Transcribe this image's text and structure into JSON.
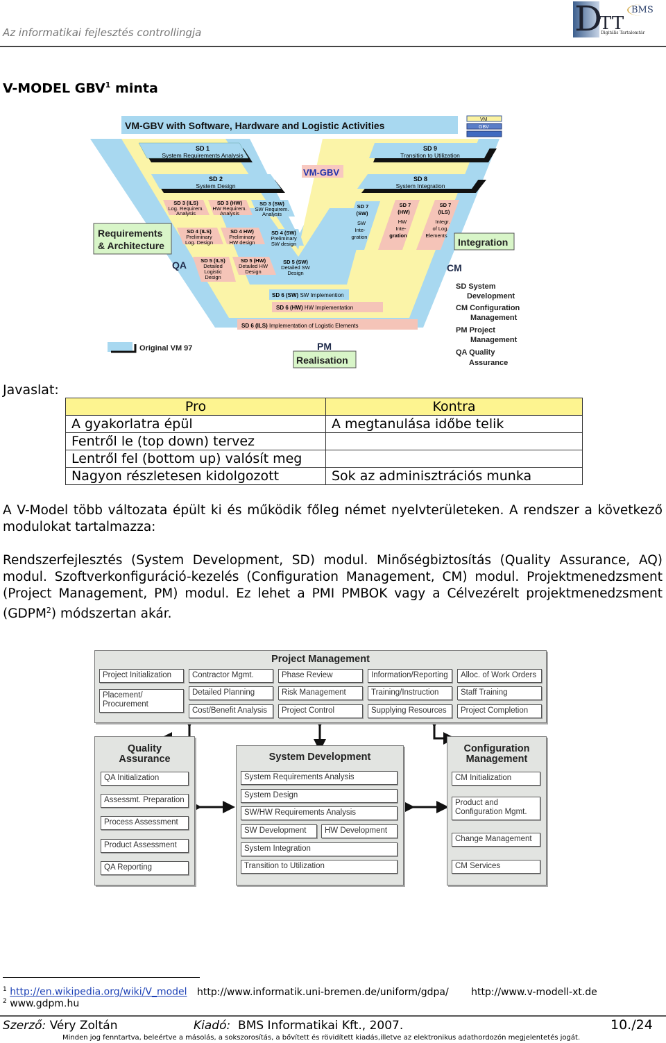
{
  "header": {
    "doc_title": "Az informatikai fejlesztés controllingja",
    "logo": {
      "big_letter": "D",
      "letters": "TT",
      "subtitle": "Digitális Tartalomtár",
      "badge": "BMS"
    }
  },
  "title": {
    "text": "V-MODEL GBV",
    "sup": "1",
    "suffix": " minta"
  },
  "vmodel": {
    "heading": "VM-GBV with Software, Hardware and Logistic Activities",
    "center_label": "VM-GBV",
    "legend_mini": [
      "VM",
      "GBV",
      ""
    ],
    "sd1": {
      "code": "SD 1",
      "name": "System Requirements Analysis"
    },
    "sd2": {
      "code": "SD 2",
      "name": "System Design"
    },
    "sd3_ils": {
      "code": "SD 3 (ILS)",
      "l1": "Log. Requirem.",
      "l2": "Analysis"
    },
    "sd3_hw": {
      "code": "SD 3 (HW)",
      "l1": "HW Requirem.",
      "l2": "Analysis"
    },
    "sd3_sw": {
      "code": "SD 3 (SW)",
      "l1": "SW Requirem.",
      "l2": "Analysis"
    },
    "sd4_ils": {
      "code": "SD 4 (ILS)",
      "l1": "Preliminary",
      "l2": "Log. Design"
    },
    "sd4_hw": {
      "code": "SD 4 HW)",
      "l1": "Preliminary",
      "l2": "HW design"
    },
    "sd4_sw": {
      "code": "SD 4 (SW)",
      "l1": "Preliminary",
      "l2": "SW design"
    },
    "sd5_ils": {
      "code": "SD 5 (ILS)",
      "l1": "Detailed",
      "l2": "Logistic",
      "l3": "Design"
    },
    "sd5_hw": {
      "code": "SD 5 (HW)",
      "l1": "Detailed HW",
      "l2": "Design"
    },
    "sd5_sw": {
      "code": "SD 5 (SW)",
      "l1": "Detailed SW",
      "l2": "Design"
    },
    "sd6_sw": {
      "code": "SD 6 (SW)",
      "name": "SW Implemention"
    },
    "sd6_hw": {
      "code": "SD 6 (HW)",
      "name": "HW Implementation"
    },
    "sd6_ils": {
      "code": "SD 6 (ILS)",
      "name": "Implementation of Logistic Elements"
    },
    "sd7_sw": {
      "code": "SD 7",
      "sub": "(SW)",
      "l1": "SW",
      "l2": "Inte-",
      "l3": "gration"
    },
    "sd7_hw": {
      "code": "SD 7",
      "sub": "(HW)",
      "l1": "HW",
      "l2": "Inte-",
      "l3": "gration"
    },
    "sd7_ils": {
      "code": "SD 7",
      "sub": "(ILS)",
      "l1": "Integr.",
      "l2": "of Log.",
      "l3": "Elements"
    },
    "sd8": {
      "code": "SD 8",
      "name": "System Integration"
    },
    "sd9": {
      "code": "SD 9",
      "name": "Transition to Utilization"
    },
    "req_arch": [
      "Requirements",
      "& Architecture"
    ],
    "integration": "Integration",
    "realisation": "Realisation",
    "qa": "QA",
    "cm": "CM",
    "pm": "PM",
    "original": "Original VM 97",
    "legend": [
      {
        "abbr": "SD",
        "l1": "System",
        "l2": "Development"
      },
      {
        "abbr": "CM",
        "l1": "Configuration",
        "l2": "Management"
      },
      {
        "abbr": "PM",
        "l1": "Project",
        "l2": "Management"
      },
      {
        "abbr": "QA",
        "l1": "Quality",
        "l2": "Assurance"
      }
    ]
  },
  "javaslat": "Javaslat:",
  "table": {
    "headers": [
      "Pro",
      "Kontra"
    ],
    "rows": [
      [
        "A gyakorlatra épül",
        "A megtanulása időbe telik"
      ],
      [
        "Fentről le (top down) tervez",
        ""
      ],
      [
        "Lentről fel (bottom up) valósít meg",
        ""
      ],
      [
        "Nagyon részletesen kidolgozott",
        "Sok az adminisztrációs munka"
      ]
    ]
  },
  "paragraphs": {
    "p1": "A V-Model több változata épült ki és működik főleg német nyelvterületeken. A rendszer a következő modulokat tartalmazza:",
    "p2_a": "Rendszerfejlesztés (System Development, SD) modul. Minőségbiztosítás (Quality Assurance, AQ) modul. Szoftverkonfiguráció-kezelés (Configuration Management, CM) modul. Projektmenedzsment (Project Management, PM) modul. Ez lehet a PMI PMBOK vagy a Célvezérelt projektmenedzsment (GDPM",
    "p2_sup": "2",
    "p2_b": ") módszertan akár."
  },
  "modules": {
    "pm": {
      "title": "Project Management",
      "cells": [
        "Project Initialization",
        "Contractor Mgmt.",
        "Phase Review",
        "Information/Reporting",
        "Alloc. of Work Orders",
        "Placement/ Procurement",
        "Detailed Planning",
        "Risk Management",
        "Training/Instruction",
        "Staff Training",
        "Cost/Benefit Analysis",
        "Project Control",
        "Supplying Resources",
        "Project Completion"
      ]
    },
    "qa": {
      "title_l1": "Quality",
      "title_l2": "Assurance",
      "cells": [
        "QA Initialization",
        "Assessmt. Preparation",
        "Process Assessment",
        "Product Assessment",
        "QA Reporting"
      ]
    },
    "sd": {
      "title": "System Development",
      "cells": [
        "System Requirements Analysis",
        "System Design",
        "SW/HW Requirements Analysis",
        "SW Development",
        "HW Development",
        "System Integration",
        "Transition to Utilization"
      ]
    },
    "cm": {
      "title_l1": "Configuration",
      "title_l2": "Management",
      "cells": [
        "CM Initialization",
        "Product and Configuration Mgmt.",
        "Change Management",
        "CM Services"
      ]
    }
  },
  "footnotes": {
    "f1_num": "1",
    "f1_link": "http://en.wikipedia.org/wiki/V_model",
    "f1_url2": "http://www.informatik.uni-bremen.de/uniform/gdpa/",
    "f1_url3": "http://www.v-modell-xt.de",
    "f2_num": "2",
    "f2_text": "www.gdpm.hu"
  },
  "footer": {
    "author_label": "Szerző:",
    "author": " Véry Zoltán",
    "publisher_label": "Kiadó:",
    "publisher": "  BMS Informatikai Kft., 2007.",
    "page": "10./24",
    "copyright": "Minden jog fenntartva, beleértve a másolás, a sokszorosítás, a bővített és rövidített kiadás,illetve az elektronikus adathordozón megjelentetés jogát."
  }
}
